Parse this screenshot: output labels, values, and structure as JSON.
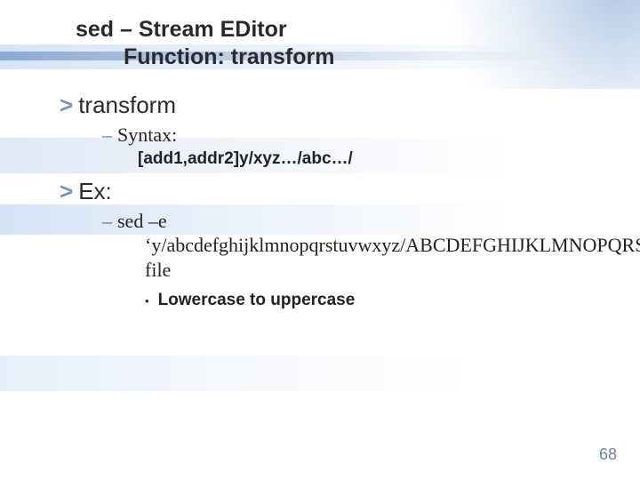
{
  "title": {
    "line1": "sed – Stream EDitor",
    "line2": "Function: transform"
  },
  "sections": [
    {
      "heading": "transform",
      "sub": {
        "label": "Syntax:",
        "code": "[add1,addr2]y/xyz…/abc…/"
      }
    },
    {
      "heading": "Ex:",
      "sub": {
        "label": "sed –e",
        "cmd": "‘y/abcdefghijklmnopqrstuvwxyz/ABCDEFGHIJKLMNOPQRSTUVWXYZ/’ file",
        "note": "Lowercase to uppercase"
      }
    }
  ],
  "page_number": "68",
  "glyphs": {
    "chevron": ">",
    "dash": "–",
    "bullet": "•"
  }
}
